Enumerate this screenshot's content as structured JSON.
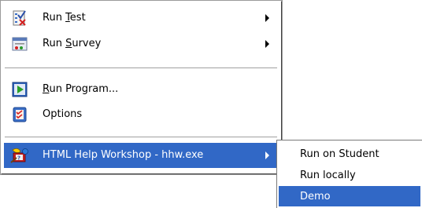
{
  "menu": {
    "items": [
      {
        "label_pre": "Run ",
        "label_key": "T",
        "label_post": "est",
        "icon": "test-checklist-icon",
        "has_submenu": true
      },
      {
        "label_pre": "Run ",
        "label_key": "S",
        "label_post": "urvey",
        "icon": "survey-window-icon",
        "has_submenu": true
      },
      {
        "label_pre": "",
        "label_key": "R",
        "label_post": "un Program...",
        "icon": "run-program-icon",
        "has_submenu": false
      },
      {
        "label_pre": "",
        "label_key": "",
        "label_post": "Options",
        "icon": "options-checklist-icon",
        "has_submenu": false
      },
      {
        "label": "HTML Help Workshop - hhw.exe",
        "icon": "help-workshop-icon",
        "has_submenu": true,
        "selected": true
      }
    ]
  },
  "submenu": {
    "items": [
      {
        "label": "Run on Student"
      },
      {
        "label": "Run locally"
      },
      {
        "label": "Demo",
        "selected": true
      }
    ]
  },
  "colors": {
    "highlight": "#3168c6",
    "highlight_text": "#ffffff",
    "menu_bg": "#ffffff"
  }
}
